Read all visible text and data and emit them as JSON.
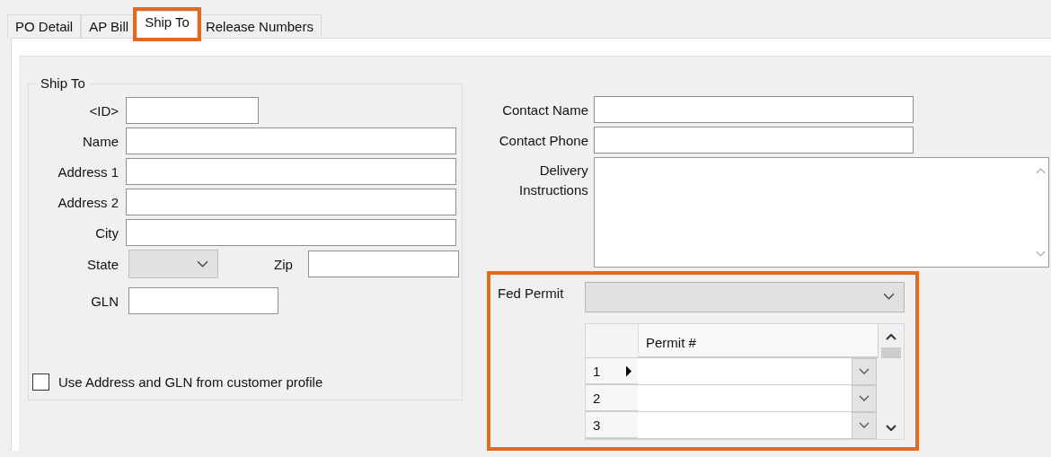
{
  "tabs": [
    {
      "label": "PO Detail",
      "selected": false,
      "highlighted": false
    },
    {
      "label": "AP Bill",
      "selected": false,
      "highlighted": false
    },
    {
      "label": "Ship To",
      "selected": true,
      "highlighted": true
    },
    {
      "label": "Release Numbers",
      "selected": false,
      "highlighted": false
    }
  ],
  "ship_to": {
    "title": "Ship To",
    "fields": [
      {
        "label": "<ID>",
        "kind": "short"
      },
      {
        "label": "Name",
        "kind": "long"
      },
      {
        "label": "Address 1",
        "kind": "long"
      },
      {
        "label": "Address 2",
        "kind": "long"
      },
      {
        "label": "City",
        "kind": "long"
      }
    ],
    "state": {
      "label": "State",
      "disabled": true
    },
    "zip": {
      "label": "Zip"
    },
    "gln": {
      "label": "GLN"
    },
    "use_customer_profile": {
      "label": "Use Address and GLN from customer profile",
      "checked": false
    }
  },
  "contact": [
    {
      "label": "Contact Name"
    },
    {
      "label": "Contact Phone"
    }
  ],
  "delivery_instructions": {
    "label": "Delivery Instructions"
  },
  "fed_permit": {
    "label": "Fed Permit",
    "disabled": true,
    "highlighted": true,
    "grid": {
      "columns": [
        "Permit #"
      ],
      "rows": [
        {
          "number": "1",
          "current": true
        },
        {
          "number": "2",
          "current": false
        },
        {
          "number": "3",
          "current": false
        }
      ]
    }
  }
}
